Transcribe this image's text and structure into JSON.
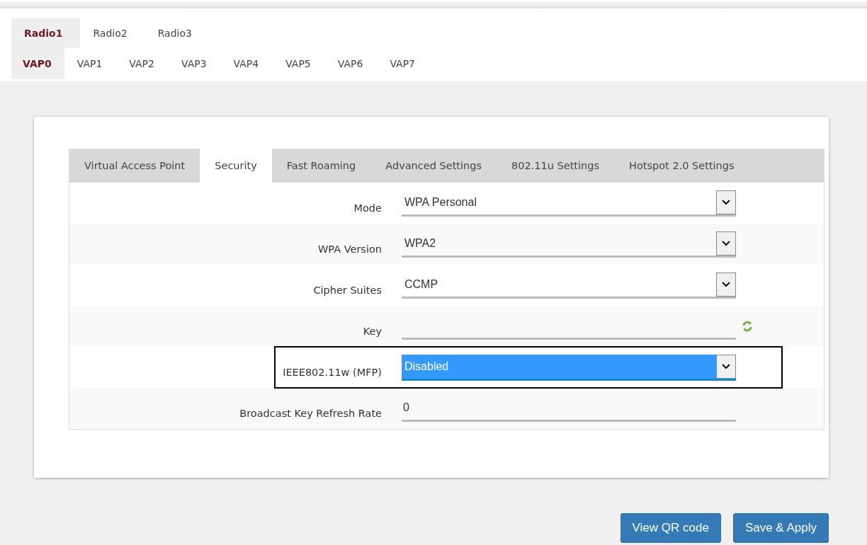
{
  "radio_tabs": [
    {
      "label": "Radio1",
      "selected": true
    },
    {
      "label": "Radio2",
      "selected": false
    },
    {
      "label": "Radio3",
      "selected": false
    }
  ],
  "vap_tabs": [
    {
      "label": "VAP0",
      "selected": true
    },
    {
      "label": "VAP1",
      "selected": false
    },
    {
      "label": "VAP2",
      "selected": false
    },
    {
      "label": "VAP3",
      "selected": false
    },
    {
      "label": "VAP4",
      "selected": false
    },
    {
      "label": "VAP5",
      "selected": false
    },
    {
      "label": "VAP6",
      "selected": false
    },
    {
      "label": "VAP7",
      "selected": false
    }
  ],
  "section_tabs": [
    {
      "label": "Virtual Access Point",
      "selected": false
    },
    {
      "label": "Security",
      "selected": true
    },
    {
      "label": "Fast Roaming",
      "selected": false
    },
    {
      "label": "Advanced Settings",
      "selected": false
    },
    {
      "label": "802.11u Settings",
      "selected": false
    },
    {
      "label": "Hotspot 2.0 Settings",
      "selected": false
    }
  ],
  "fields": [
    {
      "label": "Mode",
      "kind": "select",
      "value": "WPA Personal",
      "highlighted": false,
      "outlined": false
    },
    {
      "label": "WPA Version",
      "kind": "select",
      "value": "WPA2",
      "highlighted": false,
      "outlined": false
    },
    {
      "label": "Cipher Suites",
      "kind": "select",
      "value": "CCMP",
      "highlighted": false,
      "outlined": false
    },
    {
      "label": "Key",
      "kind": "text",
      "refresh": true,
      "highlighted": false,
      "outlined": false
    },
    {
      "label": "IEEE802.11w (MFP)",
      "kind": "select",
      "value": "Disabled",
      "highlighted": true,
      "outlined": true
    },
    {
      "label": "Broadcast Key Refresh Rate",
      "kind": "text",
      "value": "0",
      "highlighted": false,
      "outlined": false
    }
  ],
  "buttons": [
    "View QR code",
    "Save & Apply"
  ]
}
